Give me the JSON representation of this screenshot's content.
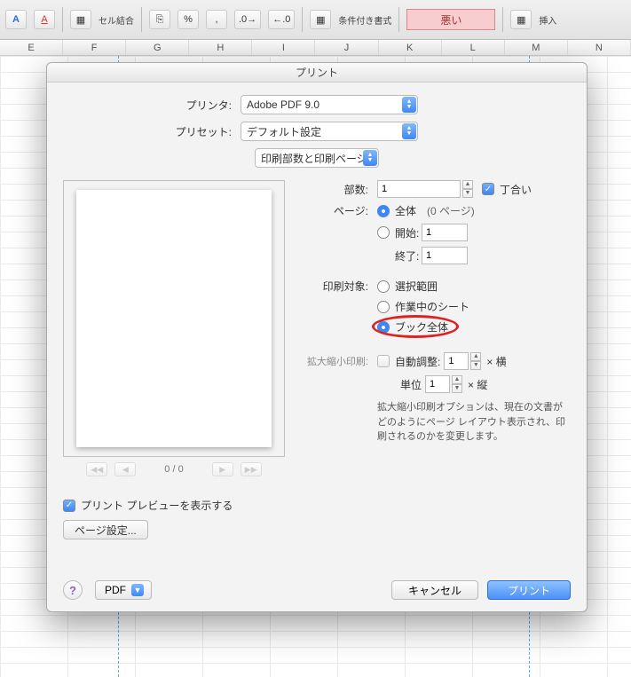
{
  "toolbar": {
    "merge_label": "セル結合",
    "percent": "%",
    "comma": ",",
    "cond_format_label": "条件付き書式",
    "style_bad": "悪い",
    "insert_label": "挿入"
  },
  "columns": [
    "E",
    "F",
    "G",
    "H",
    "I",
    "J",
    "K",
    "L",
    "M",
    "N"
  ],
  "dialog": {
    "title": "プリント",
    "printer_label": "プリンタ:",
    "printer_value": "Adobe PDF 9.0",
    "preset_label": "プリセット:",
    "preset_value": "デフォルト設定",
    "section_select": "印刷部数と印刷ページ",
    "copies": {
      "label": "部数:",
      "value": "1",
      "collate": "丁合い"
    },
    "pages": {
      "label": "ページ:",
      "all_label": "全体",
      "count_text": "(0 ページ)",
      "from_label": "開始:",
      "from_value": "1",
      "to_label": "終了:",
      "to_value": "1"
    },
    "target": {
      "label": "印刷対象:",
      "selection": "選択範囲",
      "activesheet": "作業中のシート",
      "workbook": "ブック全体"
    },
    "scaling": {
      "label": "拡大縮小印刷:",
      "fit_label": "自動調整:",
      "fit_wide_value": "1",
      "wide_suffix": "× 横",
      "unit_label": "単位",
      "fit_tall_value": "1",
      "tall_suffix": "× 縦",
      "help": "拡大縮小印刷オプションは、現在の文書がどのようにページ レイアウト表示され、印刷されるのかを変更します。"
    },
    "preview": {
      "page_indicator": "0 / 0"
    },
    "show_preview_label": "プリント プレビューを表示する",
    "page_setup_button": "ページ設定...",
    "help": "?",
    "pdf_button": "PDF",
    "cancel": "キャンセル",
    "print": "プリント"
  }
}
